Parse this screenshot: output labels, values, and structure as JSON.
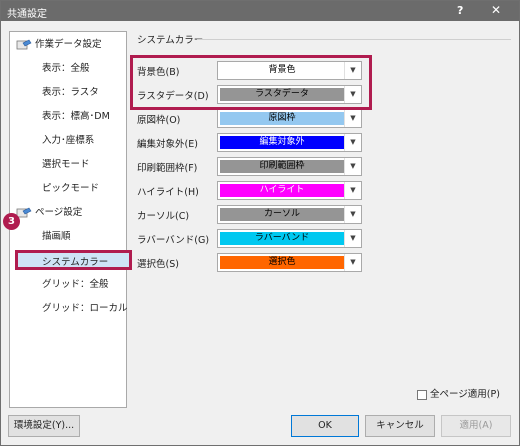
{
  "window": {
    "title": "共通設定",
    "help": "?",
    "close": "✕"
  },
  "tree": {
    "items": [
      {
        "label": "作業データ設定",
        "type": "parent",
        "icon": "work-data-icon"
      },
      {
        "label": "表示：全般",
        "type": "child"
      },
      {
        "label": "表示：ラスタ",
        "type": "child"
      },
      {
        "label": "表示：標高･DM",
        "type": "child"
      },
      {
        "label": "入力･座標系",
        "type": "child"
      },
      {
        "label": "選択モード",
        "type": "child"
      },
      {
        "label": "ピックモード",
        "type": "child"
      },
      {
        "label": "ページ設定",
        "type": "parent",
        "icon": "page-settings-icon"
      },
      {
        "label": "描画順",
        "type": "child"
      },
      {
        "label": "システムカラー",
        "type": "child",
        "selected": true
      },
      {
        "label": "グリッド：全般",
        "type": "child"
      },
      {
        "label": "グリッド：ローカル",
        "type": "child"
      }
    ]
  },
  "marker": "3",
  "section": {
    "title": "システムカラー"
  },
  "colors": [
    {
      "label": "背景色(B)",
      "value": "背景色",
      "bg": "#ffffff",
      "fg": "#000000"
    },
    {
      "label": "ラスタデータ(D)",
      "value": "ラスタデータ",
      "bg": "#959595",
      "fg": "#000000"
    },
    {
      "label": "原図枠(O)",
      "value": "原図枠",
      "bg": "#94c8f0",
      "fg": "#000000"
    },
    {
      "label": "編集対象外(E)",
      "value": "編集対象外",
      "bg": "#0000ff",
      "fg": "#ffffff"
    },
    {
      "label": "印刷範囲枠(F)",
      "value": "印刷範囲枠",
      "bg": "#959595",
      "fg": "#000000"
    },
    {
      "label": "ハイライト(H)",
      "value": "ハイライト",
      "bg": "#ff00ff",
      "fg": "#ffffff"
    },
    {
      "label": "カーソル(C)",
      "value": "カーソル",
      "bg": "#959595",
      "fg": "#000000"
    },
    {
      "label": "ラバーバンド(G)",
      "value": "ラバーバンド",
      "bg": "#00c8f0",
      "fg": "#000000"
    },
    {
      "label": "選択色(S)",
      "value": "選択色",
      "bg": "#ff6600",
      "fg": "#000000"
    }
  ],
  "checkbox": {
    "label": "全ページ適用(P)",
    "checked": false
  },
  "buttons": {
    "env": "環境設定(Y)...",
    "ok": "OK",
    "cancel": "キャンセル",
    "apply": "適用(A)"
  }
}
